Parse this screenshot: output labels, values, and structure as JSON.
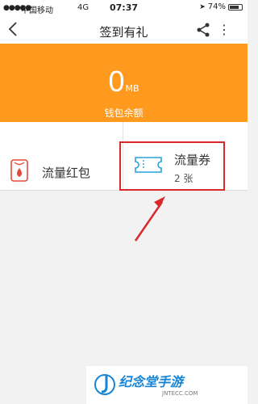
{
  "status_bar": {
    "carrier": "中国移动",
    "network": "4G",
    "time": "07:37",
    "battery": "74%"
  },
  "nav": {
    "back_icon": "chevron-left-icon",
    "title": "签到有礼",
    "share_icon": "share-icon",
    "more_icon": "more-icon"
  },
  "balance": {
    "amount": "0",
    "unit": "MB",
    "label": "钱包余额"
  },
  "cards": {
    "red_packet": {
      "label": "流量红包",
      "icon": "red-packet-icon"
    },
    "voucher": {
      "label": "流量券",
      "count": "2 张",
      "icon": "ticket-icon"
    }
  },
  "watermark": {
    "brand": "纪念堂手游",
    "domain": "JNTECC.COM"
  },
  "colors": {
    "accent": "#ff9a1f",
    "highlight": "#d9282a",
    "ticket": "#28a3d8",
    "red_packet": "#e14b3c"
  }
}
